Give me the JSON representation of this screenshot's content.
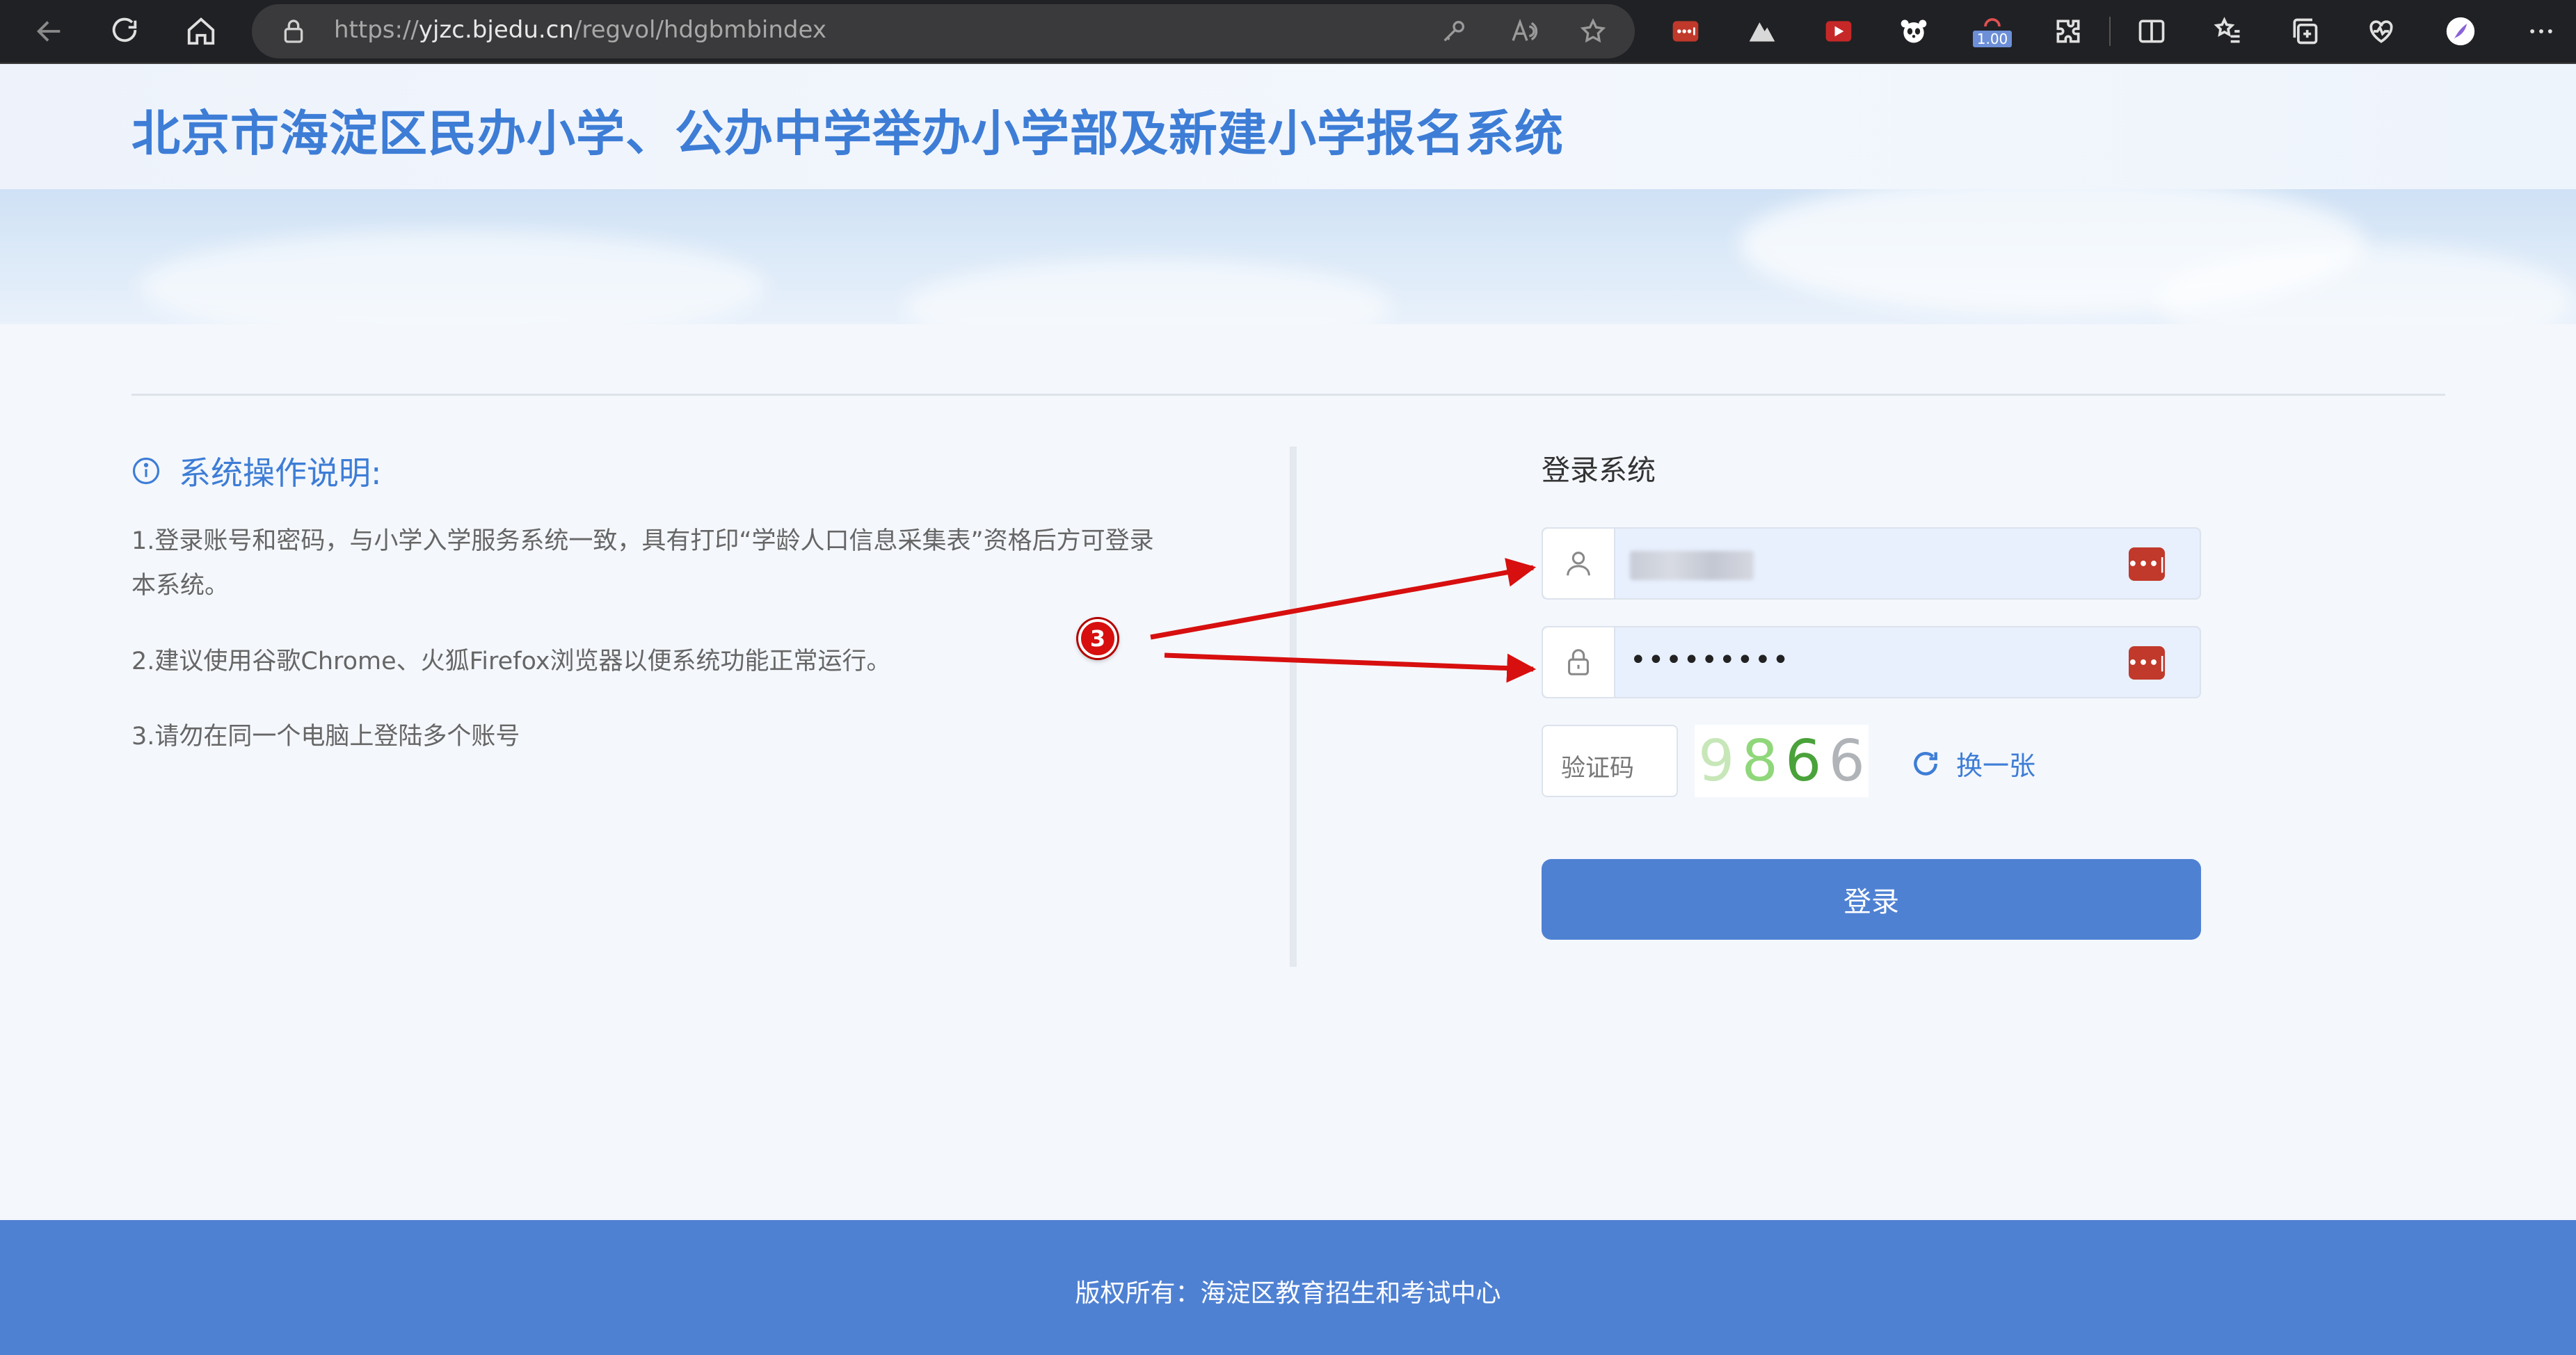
{
  "browser": {
    "url_prefix": "https://",
    "url_domain": "yjzc.bjedu.cn",
    "url_path": "/regvol/hdgbmbindex",
    "extension_badge": "1.00"
  },
  "header": {
    "title": "北京市海淀区民办小学、公办中学举办小学部及新建小学报名系统"
  },
  "instructions": {
    "title": "系统操作说明:",
    "lines": [
      "1.登录账号和密码，与小学入学服务系统一致，具有打印“学龄人口信息采集表”资格后方可登录",
      "本系统。",
      "2.建议使用谷歌Chrome、火狐Firefox浏览器以便系统功能正常运行。",
      "3.请勿在同一个电脑上登陆多个账号"
    ]
  },
  "login": {
    "title": "登录系统",
    "password_mask": "•••••••••",
    "pm_icon_text": "•••|",
    "captcha_placeholder": "验证码",
    "captcha_digits": [
      "9",
      "8",
      "6",
      "6"
    ],
    "captcha_colors": [
      "#c7e7b9",
      "#8fd77a",
      "#4aa23a",
      "#b0b4b8"
    ],
    "refresh_label": "换一张",
    "submit_label": "登录"
  },
  "annotation": {
    "badge": "3"
  },
  "footer": {
    "copyright": "版权所有：海淀区教育招生和考试中心"
  },
  "colors": {
    "accent": "#3d7dd6",
    "button": "#4f81d3",
    "annotation_red": "#d70f0f"
  },
  "icons": {
    "back": "arrow-left-icon",
    "reload": "reload-icon",
    "home": "home-icon",
    "lock": "lock-icon",
    "user": "user-icon",
    "password": "padlock-icon",
    "refresh": "refresh-icon",
    "info": "info-icon"
  }
}
